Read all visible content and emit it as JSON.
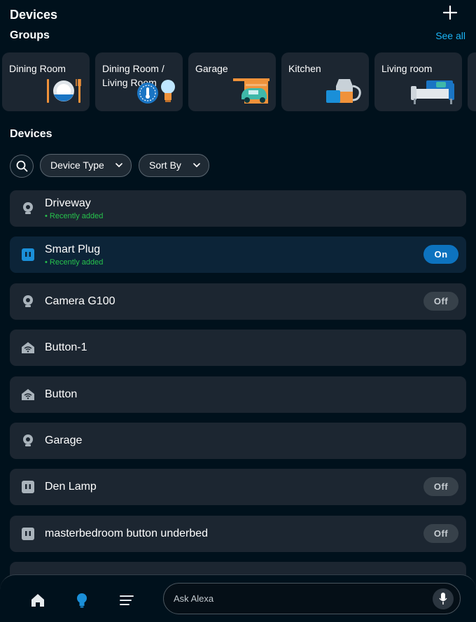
{
  "header": {
    "title": "Devices",
    "add_icon": "plus-icon"
  },
  "groups_section": {
    "title": "Groups",
    "see_all": "See all"
  },
  "groups": [
    {
      "label": "Dining Room",
      "icon": "dining-plate-icon"
    },
    {
      "label": "Dining Room / Living Room",
      "icon": "thermostat-bulb-icon"
    },
    {
      "label": "Garage",
      "icon": "garage-car-icon"
    },
    {
      "label": "Kitchen",
      "icon": "kitchen-jug-icon"
    },
    {
      "label": "Living room",
      "icon": "sofa-icon"
    }
  ],
  "devices_section": {
    "title": "Devices"
  },
  "filters": {
    "search_icon": "search-icon",
    "device_type": "Device Type",
    "sort_by": "Sort By"
  },
  "devices": [
    {
      "name": "Driveway",
      "subtitle": "• Recently added",
      "icon": "camera-icon",
      "toggle": ""
    },
    {
      "name": "Smart Plug",
      "subtitle": "• Recently added",
      "icon": "plug-icon",
      "toggle": "On",
      "selected": true
    },
    {
      "name": "Camera G100",
      "subtitle": "",
      "icon": "camera-icon",
      "toggle": "Off"
    },
    {
      "name": "Button-1",
      "subtitle": "",
      "icon": "wifi-home-icon",
      "toggle": ""
    },
    {
      "name": "Button",
      "subtitle": "",
      "icon": "wifi-home-icon",
      "toggle": ""
    },
    {
      "name": "Garage",
      "subtitle": "",
      "icon": "camera-icon",
      "toggle": ""
    },
    {
      "name": "Den Lamp",
      "subtitle": "",
      "icon": "plug-icon",
      "toggle": "Off"
    },
    {
      "name": "masterbedroom button underbed",
      "subtitle": "",
      "icon": "plug-icon",
      "toggle": "Off"
    }
  ],
  "bottom_nav": {
    "home_icon": "home-icon",
    "devices_icon": "bulb-icon",
    "more_icon": "menu-icon",
    "ask_placeholder": "Ask Alexa",
    "mic_icon": "microphone-icon"
  },
  "colors": {
    "background": "#00111c",
    "card": "#1c2631",
    "accent": "#1bb4f5",
    "toggle_on": "#0d73bf",
    "recently_added": "#27c24c"
  }
}
